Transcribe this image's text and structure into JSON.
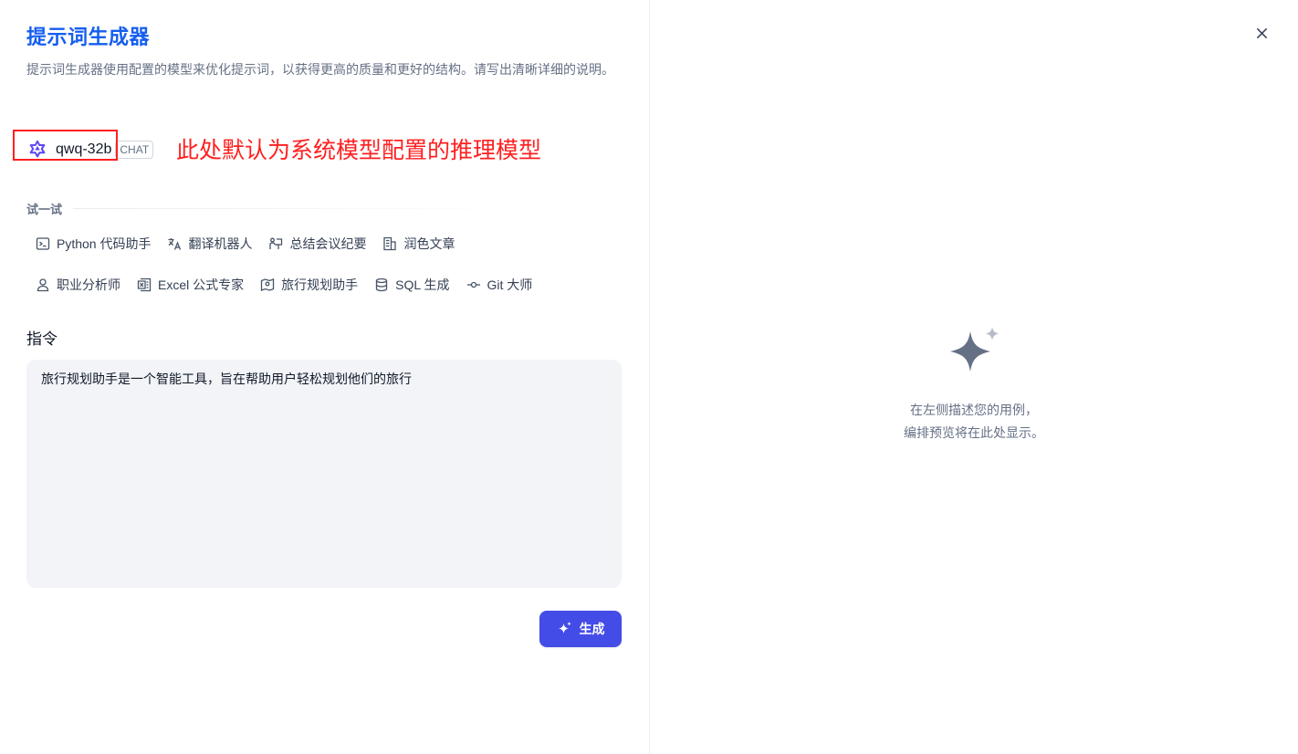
{
  "header": {
    "title": "提示词生成器",
    "description": "提示词生成器使用配置的模型来优化提示词，以获得更高的质量和更好的结构。请写出清晰详细的说明。"
  },
  "model": {
    "icon": "model-logo-icon",
    "name": "qwq-32b",
    "badge": "CHAT"
  },
  "annotation": {
    "text": "此处默认为系统模型配置的推理模型",
    "color": "#ff1f1f"
  },
  "try_section": {
    "label": "试一试",
    "row1": [
      {
        "label": "Python 代码助手",
        "icon": "terminal-icon"
      },
      {
        "label": "翻译机器人",
        "icon": "translate-icon"
      },
      {
        "label": "总结会议纪要",
        "icon": "meeting-icon"
      },
      {
        "label": "润色文章",
        "icon": "document-icon"
      }
    ],
    "row2": [
      {
        "label": "职业分析师",
        "icon": "user-icon"
      },
      {
        "label": "Excel 公式专家",
        "icon": "excel-icon"
      },
      {
        "label": "旅行规划助手",
        "icon": "map-pin-icon"
      },
      {
        "label": "SQL 生成",
        "icon": "database-icon"
      },
      {
        "label": "Git 大师",
        "icon": "git-commit-icon"
      }
    ]
  },
  "instruction": {
    "label": "指令",
    "value": "旅行规划助手是一个智能工具，旨在帮助用户轻松规划他们的旅行"
  },
  "generate_button": {
    "label": "生成",
    "color": "#444ce7"
  },
  "preview": {
    "empty_line1": "在左侧描述您的用例，",
    "empty_line2": "编排预览将在此处显示。"
  },
  "colors": {
    "title": "#155eef",
    "muted_text": "#667085",
    "input_bg": "#f2f4f7"
  }
}
